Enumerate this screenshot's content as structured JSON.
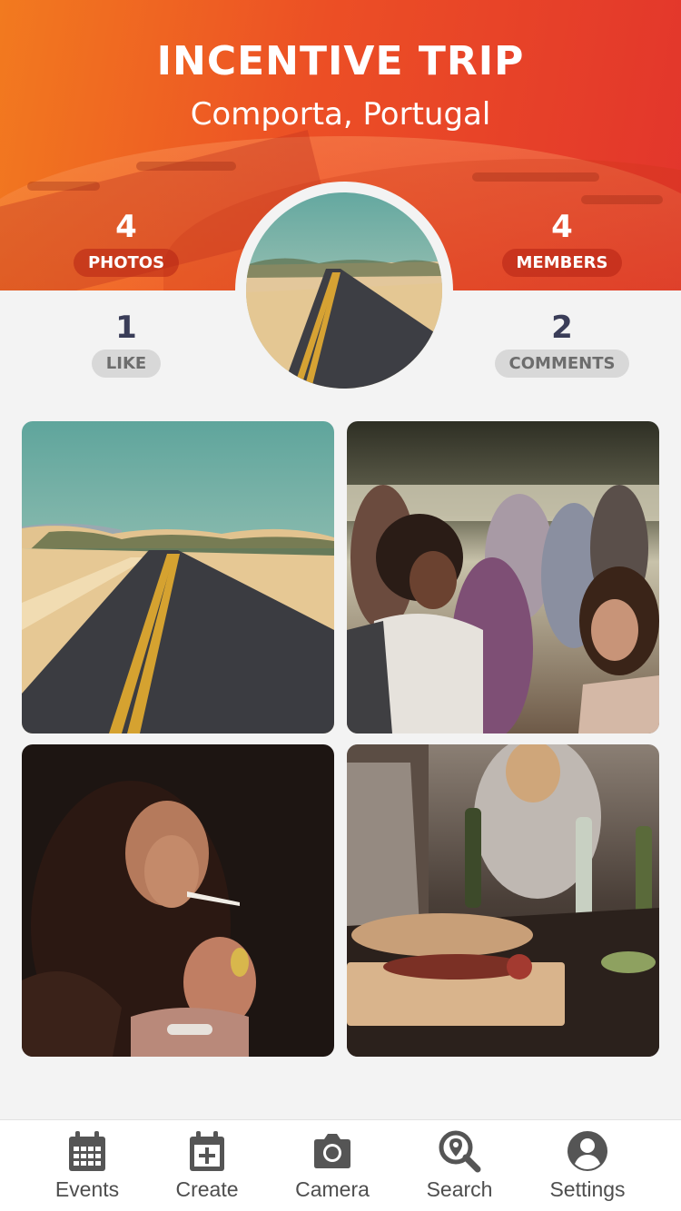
{
  "header": {
    "title": "INCENTIVE TRIP",
    "subtitle": "Comporta, Portugal",
    "gradient": [
      "#f27a1f",
      "#ec4f25",
      "#e2352c"
    ]
  },
  "stats": {
    "photos": {
      "value": "4",
      "label": "PHOTOS"
    },
    "members": {
      "value": "4",
      "label": "MEMBERS"
    },
    "likes": {
      "value": "1",
      "label": "LIKE"
    },
    "comments": {
      "value": "2",
      "label": "COMMENTS"
    }
  },
  "avatar": {
    "subject": "desert road"
  },
  "photos": [
    {
      "subject": "desert road"
    },
    {
      "subject": "people dancing"
    },
    {
      "subject": "woman lighting cigarette"
    },
    {
      "subject": "table with wine and food"
    }
  ],
  "tabs": [
    {
      "label": "Events",
      "icon": "calendar-grid-icon"
    },
    {
      "label": "Create",
      "icon": "calendar-plus-icon"
    },
    {
      "label": "Camera",
      "icon": "camera-icon"
    },
    {
      "label": "Search",
      "icon": "search-location-icon"
    },
    {
      "label": "Settings",
      "icon": "user-circle-icon"
    }
  ],
  "colors": {
    "stat_number_body": "#3a3d58",
    "pill_body": "#d8d8d8",
    "tab_icon": "#555555"
  }
}
